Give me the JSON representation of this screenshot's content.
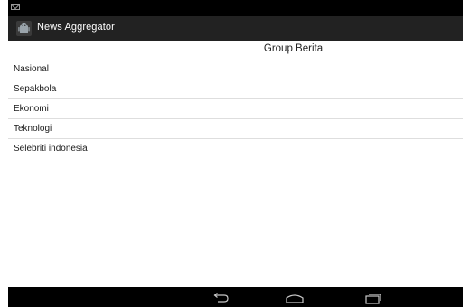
{
  "status_bar": {
    "notification_icon": "mail-icon"
  },
  "action_bar": {
    "title": "News Aggregator",
    "icon": "android-app-icon"
  },
  "header": {
    "title": "Group Berita"
  },
  "list": {
    "items": [
      {
        "label": "Nasional"
      },
      {
        "label": "Sepakbola"
      },
      {
        "label": "Ekonomi"
      },
      {
        "label": "Teknologi"
      },
      {
        "label": "Selebriti indonesia"
      }
    ]
  },
  "nav_bar": {
    "buttons": [
      "back-icon",
      "home-icon",
      "recent-apps-icon"
    ]
  },
  "colors": {
    "action_bar": "#222222",
    "status_bar": "#000000",
    "nav_bar": "#000000",
    "divider": "#dedede"
  }
}
